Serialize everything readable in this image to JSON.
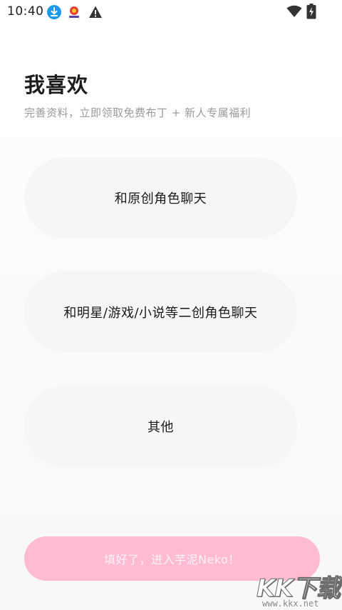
{
  "status_bar": {
    "time": "10:40",
    "icons": [
      "download-icon",
      "app-notification-icon",
      "warning-icon",
      "wifi-icon",
      "battery-icon"
    ]
  },
  "header": {
    "title": "我喜欢",
    "subtitle": "完善资料，立即领取免费布丁 + 新人专属福利"
  },
  "options": [
    {
      "label": "和原创角色聊天"
    },
    {
      "label": "和明星/游戏/小说等二创角色聊天"
    },
    {
      "label": "其他"
    }
  ],
  "submit": {
    "label": "填好了，进入芋泥Neko！"
  },
  "watermark": {
    "main": "KK下载",
    "url": "www.kkx.net"
  },
  "colors": {
    "submit_bg": "#ffbcd0",
    "option_bg": "#f6f6f7",
    "accent_blue": "#1e9be8"
  }
}
